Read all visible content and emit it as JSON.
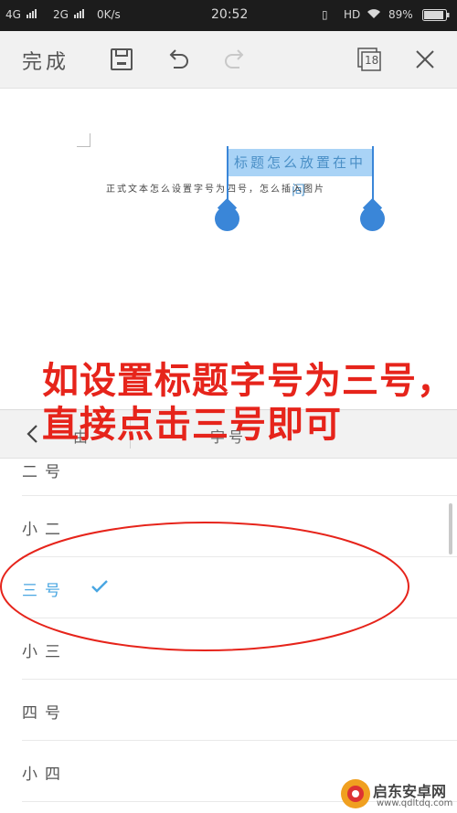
{
  "status_bar": {
    "network_1": "4G",
    "network_2": "2G",
    "speed": "0K/s",
    "time": "20:52",
    "hd": "HD",
    "battery": "89%"
  },
  "toolbar": {
    "done_label": "完成",
    "page_count": "18",
    "icons": [
      "save-icon",
      "undo-icon",
      "redo-icon",
      "pages-icon",
      "close-icon"
    ]
  },
  "document": {
    "selected_title": "标题怎么放置在中间",
    "body_text": "正式文本怎么设置字号为四号，怎么插入图片"
  },
  "panel": {
    "title": "字号",
    "header_partial": "由",
    "font_sizes": [
      {
        "label": "二号",
        "selected": false
      },
      {
        "label": "小二",
        "selected": false
      },
      {
        "label": "三号",
        "selected": true
      },
      {
        "label": "小三",
        "selected": false
      },
      {
        "label": "四号",
        "selected": false
      },
      {
        "label": "小四",
        "selected": false
      }
    ]
  },
  "annotation": {
    "text": "如设置标题字号为三号，直接点击三号即可",
    "color": "#e6241b"
  },
  "watermark": {
    "text": "启东安卓网",
    "url": "www.qdltdq.com"
  },
  "colors": {
    "selection": "#a9d3f6",
    "handle": "#3a86d8",
    "selected_item": "#49a6e2"
  }
}
